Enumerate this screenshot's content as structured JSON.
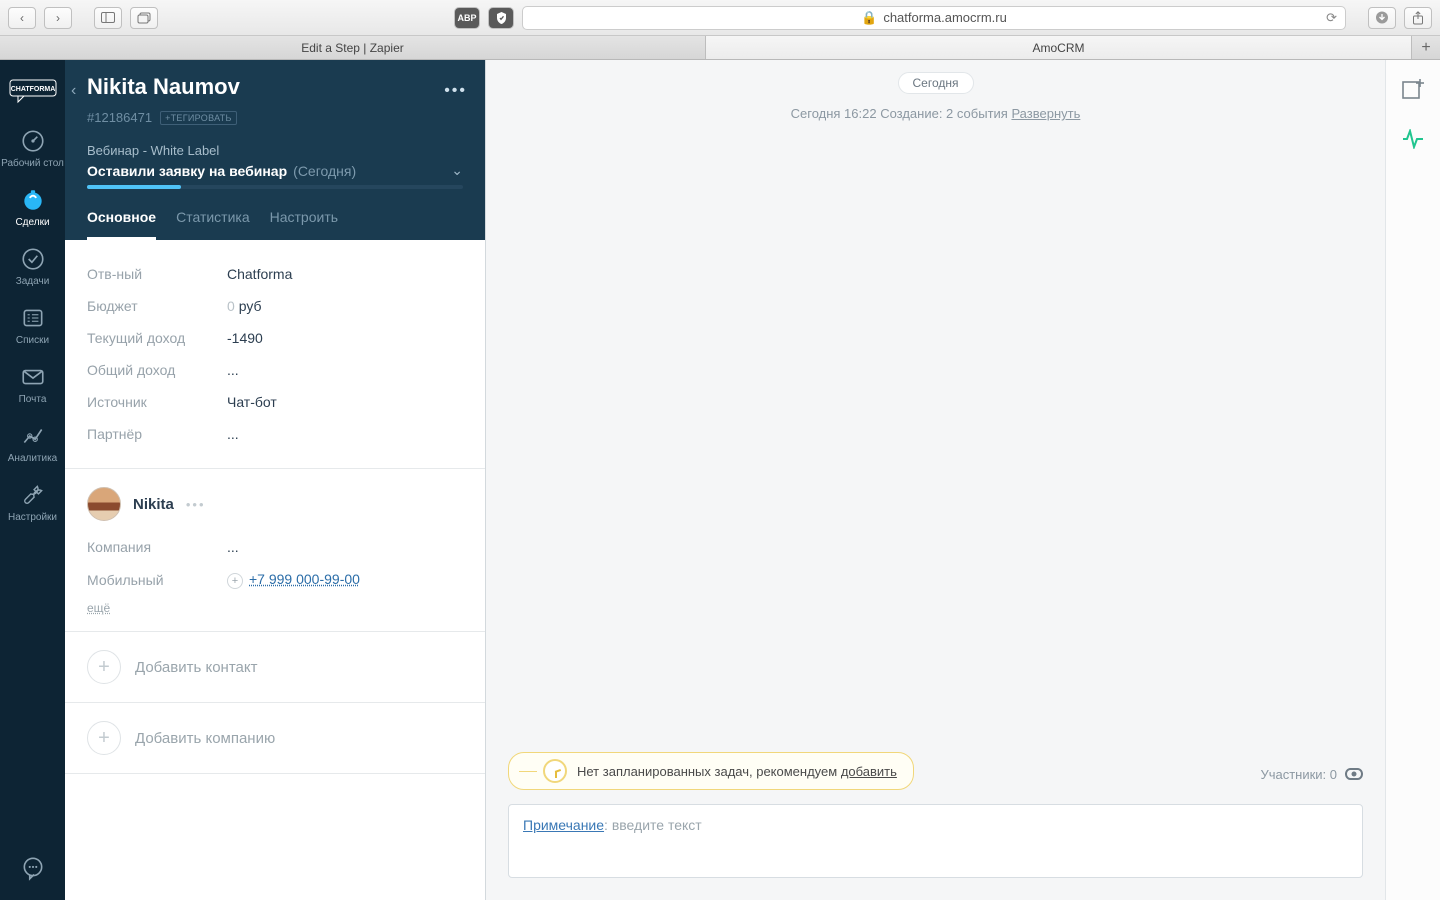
{
  "browser": {
    "address": "chatforma.amocrm.ru",
    "tabs": [
      "Edit a Step | Zapier",
      "AmoCRM"
    ],
    "active_tab_index": 1
  },
  "rail": {
    "logo": "CHATFORMA",
    "items": [
      {
        "label": "Рабочий стол"
      },
      {
        "label": "Сделки"
      },
      {
        "label": "Задачи"
      },
      {
        "label": "Списки"
      },
      {
        "label": "Почта"
      },
      {
        "label": "Аналитика"
      },
      {
        "label": "Настройки"
      }
    ]
  },
  "lead": {
    "title": "Nikita Naumov",
    "id": "#12186471",
    "tag_button": "+ТЕГИРОВАТЬ",
    "pipeline": "Вебинар - White Label",
    "stage": "Оставили заявку на вебинар",
    "stage_date": "(Сегодня)",
    "tabs": {
      "main": "Основное",
      "stats": "Статистика",
      "setup": "Настроить"
    },
    "fields": {
      "responsible_label": "Отв-ный",
      "responsible_value": "Chatforma",
      "budget_label": "Бюджет",
      "budget_value": "0",
      "budget_currency": "руб",
      "current_income_label": "Текущий доход",
      "current_income_value": "-1490",
      "total_income_label": "Общий доход",
      "total_income_value": "...",
      "source_label": "Источник",
      "source_value": "Чат-бот",
      "partner_label": "Партнёр",
      "partner_value": "..."
    }
  },
  "contact": {
    "name": "Nikita",
    "company_label": "Компания",
    "company_value": "...",
    "mobile_label": "Мобильный",
    "mobile_value": "+7 999 000-99-00",
    "more": "ещё"
  },
  "add": {
    "contact": "Добавить контакт",
    "company": "Добавить компанию"
  },
  "feed": {
    "today_pill": "Сегодня",
    "meta_prefix": "Сегодня 16:22 Создание: 2 события ",
    "meta_expand": "Развернуть",
    "task_banner_text": "Нет запланированных задач, рекомендуем ",
    "task_banner_link": "добавить",
    "participants_label": "Участники: 0",
    "note_label": "Примечание",
    "note_placeholder": ": введите текст"
  }
}
